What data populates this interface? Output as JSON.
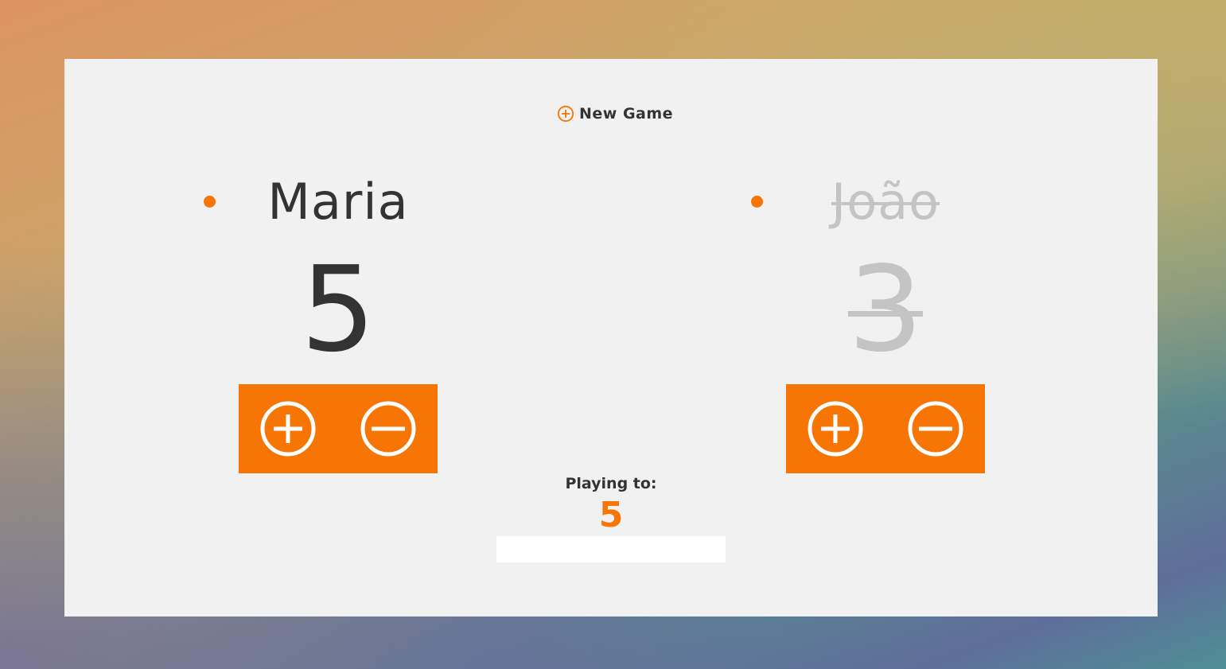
{
  "theme": {
    "accent": "#f77505",
    "card_background": "#f1f1f1",
    "active_text": "#333333",
    "inactive_text": "#c4c4c4"
  },
  "header": {
    "new_game_label": "New Game",
    "new_game_icon": "plus-circle-icon"
  },
  "players": [
    {
      "name": "Maria",
      "score": "5",
      "status": "active",
      "increment_icon": "plus-circle-icon",
      "decrement_icon": "minus-circle-icon"
    },
    {
      "name": "João",
      "score": "3",
      "status": "inactive",
      "increment_icon": "plus-circle-icon",
      "decrement_icon": "minus-circle-icon"
    }
  ],
  "playing_to": {
    "label": "Playing to:",
    "value": "5",
    "input_value": ""
  }
}
